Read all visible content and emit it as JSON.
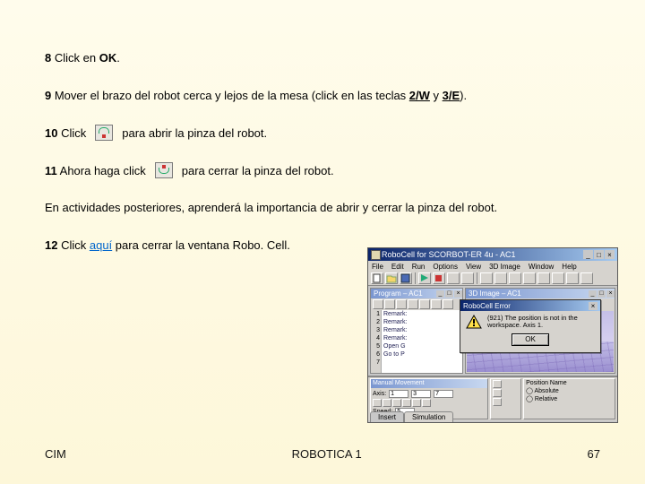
{
  "steps": {
    "s8": {
      "num": "8",
      "text_a": " Click en ",
      "ok": "OK",
      "text_b": "."
    },
    "s9": {
      "num": "9",
      "text_a": " Mover el brazo del robot cerca y lejos de la mesa (click en las teclas ",
      "k1": "2/W",
      "mid": " y ",
      "k2": "3/E",
      "end": ")."
    },
    "s10": {
      "num": "10",
      "text_a": " Click ",
      "text_b": "para abrir la pinza del robot."
    },
    "s11": {
      "num": "11",
      "text_a": " Ahora haga click ",
      "text_b": "para cerrar la pinza del robot."
    },
    "intro": "En actividades posteriores, aprenderá la importancia de abrir y cerrar la pinza del robot.",
    "s12": {
      "num": "12",
      "text_a": " Click ",
      "link": "aquí",
      "text_b": " para cerrar la ventana Robo. Cell."
    }
  },
  "footer": {
    "left": "CIM",
    "center": "ROBOTICA 1",
    "right": "67"
  },
  "app": {
    "title": "RoboCell for SCORBOT-ER 4u - AC1",
    "menus": [
      "File",
      "Edit",
      "Run",
      "Options",
      "View",
      "3D Image",
      "Window",
      "Help"
    ],
    "prog_title": "Program – AC1",
    "view_title": "3D Image – AC1",
    "lines": [
      "1",
      "2",
      "3",
      "4",
      "5",
      "6",
      "7"
    ],
    "cmds": [
      "Remark:",
      "Remark:",
      "Remark:",
      "Remark:",
      "",
      "Open G",
      "Go to P"
    ],
    "dialog": {
      "title": "RoboCell Error",
      "msg": "(921) The position is not in the workspace. Axis 1.",
      "ok": "OK"
    },
    "manual_title": "Manual Movement",
    "axis_label": "Axis:",
    "axis_vals": [
      "1",
      "3",
      "7"
    ],
    "speed_label": "Speed:",
    "speed_val": "5",
    "pa_title": "Position Name",
    "pa_rows": [
      "Absolute",
      "Relative"
    ],
    "tabs": [
      "Insert",
      "Simulation"
    ]
  }
}
